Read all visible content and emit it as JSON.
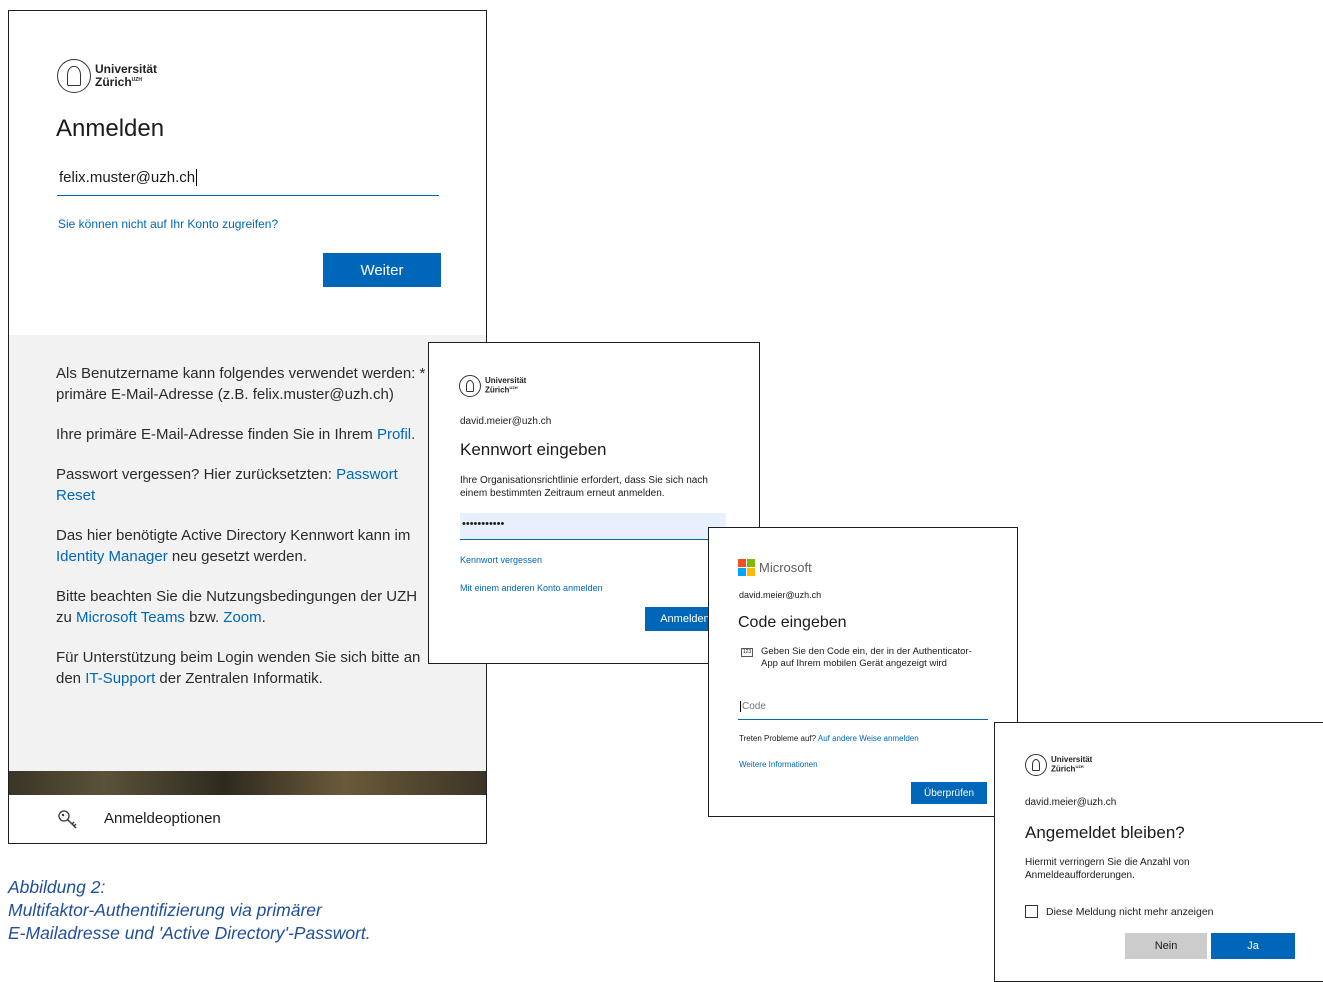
{
  "panel1": {
    "logo": {
      "line1": "Universität",
      "line2": "Zürich",
      "sup": "UZH"
    },
    "title": "Anmelden",
    "email_value": "felix.muster@uzh.ch",
    "cant_access_link": "Sie können nicht auf Ihr Konto zugreifen?",
    "next_button": "Weiter",
    "info": {
      "p1": "Als Benutzername kann folgendes verwendet werden: * primäre E-Mail-Adresse (z.B. felix.muster@uzh.ch)",
      "p2_text": "Ihre primäre E-Mail-Adresse finden Sie in Ihrem ",
      "p2_link": "Profil",
      "p2_end": ".",
      "p3_text": "Passwort vergessen? Hier zurücksetzten: ",
      "p3_link": "Passwort Reset",
      "p4_text1": "Das hier benötigte Active Directory Kennwort kann im ",
      "p4_link": "Identity Manager",
      "p4_text2": " neu gesetzt werden.",
      "p5_text1": "Bitte beachten Sie die Nutzungsbedingungen der UZH zu ",
      "p5_link1": "Microsoft Teams",
      "p5_text2": " bzw. ",
      "p5_link2": "Zoom",
      "p5_end": ".",
      "p6_text1": "Für Unterstützung beim Login wenden Sie sich bitte an den ",
      "p6_link": "IT-Support",
      "p6_text2": " der Zentralen Informatik."
    },
    "signin_options": "Anmeldeoptionen"
  },
  "panel2": {
    "logo": {
      "line1": "Universität",
      "line2": "Zürich",
      "sup": "UZH"
    },
    "account": "david.meier@uzh.ch",
    "title": "Kennwort eingeben",
    "desc": "Ihre Organisationsrichtlinie erfordert, dass Sie sich nach einem bestimmten Zeitraum erneut anmelden.",
    "password_mask": "•••••••••••",
    "forgot_link": "Kennwort vergessen",
    "other_account_link": "Mit einem anderen Konto anmelden",
    "signin_button": "Anmelden"
  },
  "panel3": {
    "brand": "Microsoft",
    "account": "david.meier@uzh.ch",
    "title": "Code eingeben",
    "desc": "Geben Sie den Code ein, der in der Authenticator-App auf Ihrem mobilen Gerät angezeigt wird",
    "code_placeholder": "Code",
    "trouble_text": "Treten Probleme auf? ",
    "trouble_link": "Auf andere Weise anmelden",
    "more_info_link": "Weitere Informationen",
    "verify_button": "Überprüfen"
  },
  "panel4": {
    "logo": {
      "line1": "Universität",
      "line2": "Zürich",
      "sup": "UZH"
    },
    "account": "david.meier@uzh.ch",
    "title": "Angemeldet bleiben?",
    "desc": "Hiermit verringern Sie die Anzahl von Anmeldeaufforderungen.",
    "checkbox_label": "Diese Meldung nicht mehr anzeigen",
    "no_button": "Nein",
    "yes_button": "Ja"
  },
  "caption": {
    "line1": "Abbildung 2:",
    "line2": "Multifaktor-Authentifizierung via primärer",
    "line3": "E-Mailadresse und 'Active Directory'-Passwort."
  },
  "colors": {
    "accent": "#0067b8",
    "caption": "#1f4e9e",
    "info_bg": "#f2f2f2"
  }
}
